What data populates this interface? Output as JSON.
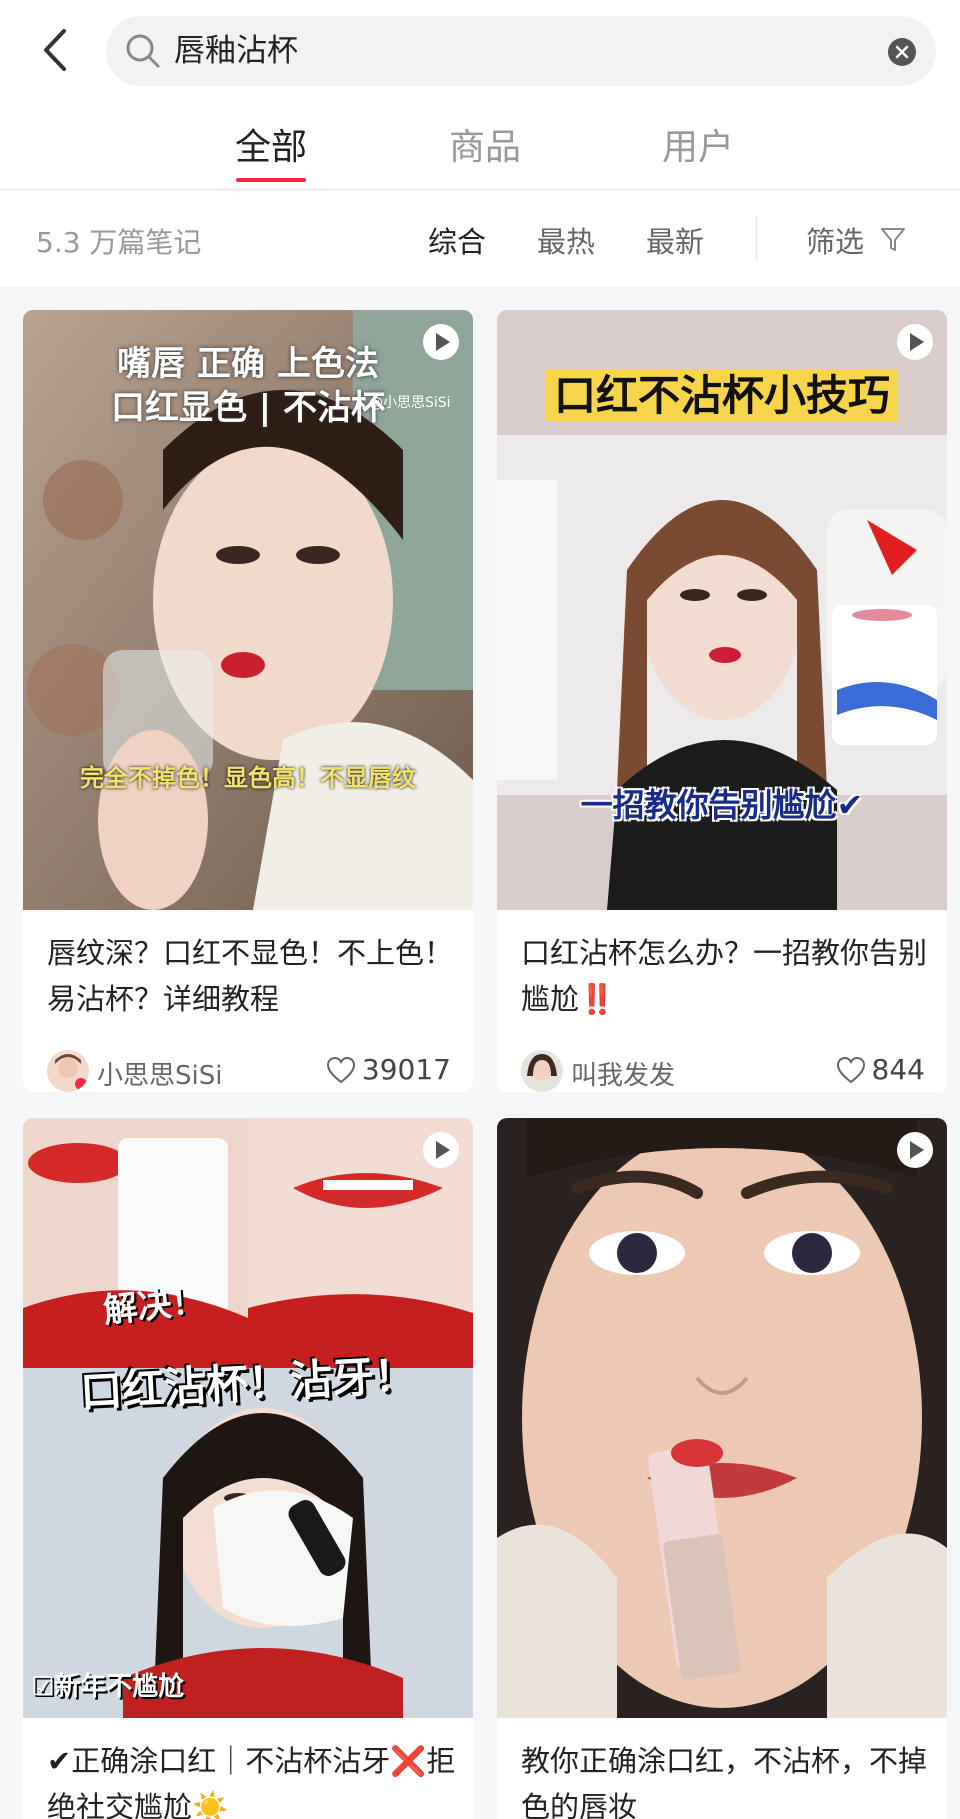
{
  "search": {
    "query": "唇釉沾杯"
  },
  "tabs": [
    {
      "label": "全部",
      "active": true
    },
    {
      "label": "商品",
      "active": false
    },
    {
      "label": "用户",
      "active": false
    }
  ],
  "filter": {
    "count": "5.3 万篇笔记",
    "sort_options": [
      "综合",
      "最热",
      "最新"
    ],
    "active_sort": "综合",
    "filter_label": "筛选"
  },
  "accent_color": "#ff2442",
  "cards": [
    {
      "overlay_lines": [
        "嘴唇 正确 上色法",
        "口红显色 | 不沾杯"
      ],
      "watermark": "@小思思SiSi",
      "caption": "完全不掉色！显色高！不显唇纹",
      "title": "唇纹深？口红不显色！不上色！易沾杯？详细教程",
      "author": "小思思SiSi",
      "likes": "39017"
    },
    {
      "overlay_lines": [
        "口红不沾杯小技巧"
      ],
      "caption": "一招教你告别尴尬✔",
      "title": "口红沾杯怎么办？一招教你告别尴尬‼️",
      "author": "叫我发发",
      "likes": "844"
    },
    {
      "overlay_lines": [
        "解决！",
        "口红沾杯！沾牙！"
      ],
      "caption": "☑新年不尴尬",
      "title": "✔正确涂口红｜不沾杯沾牙❌拒绝社交尴尬☀️"
    },
    {
      "title": "教你正确涂口红，不沾杯，不掉色的唇妆"
    }
  ]
}
